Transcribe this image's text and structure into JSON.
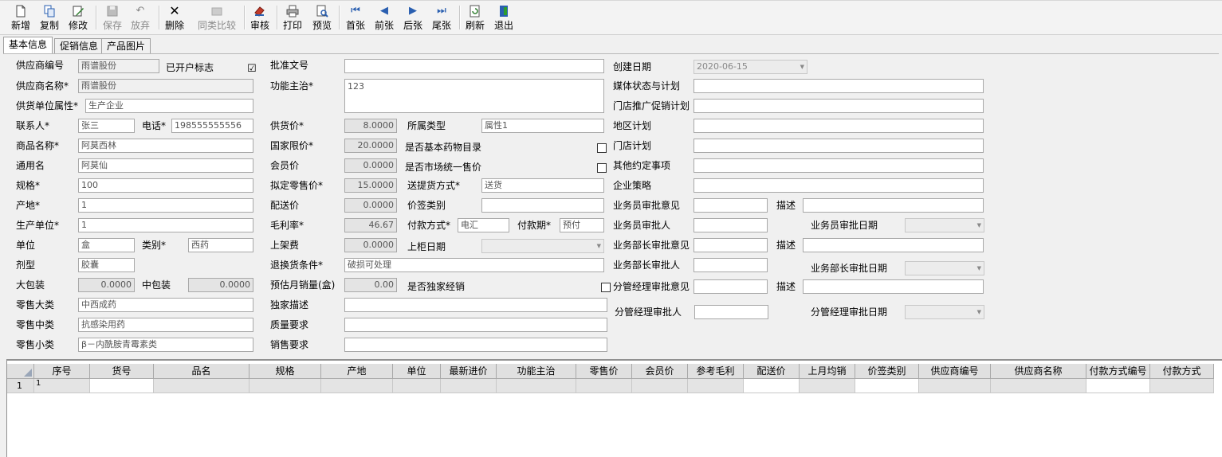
{
  "toolbar": {
    "new": "新增",
    "copy": "复制",
    "edit": "修改",
    "save": "保存",
    "discard": "放弃",
    "delete": "删除",
    "compare": "同类比较",
    "audit": "审核",
    "print": "打印",
    "preview": "预览",
    "first": "首张",
    "prev": "前张",
    "next": "后张",
    "last": "尾张",
    "refresh": "刷新",
    "exit": "退出"
  },
  "tabs": [
    "基本信息",
    "促销信息",
    "产品图片"
  ],
  "form": {
    "supplier_code": {
      "label": "供应商编号",
      "value": "雨谱股份"
    },
    "opened_flag": {
      "label": "已开户标志",
      "checked": "☑"
    },
    "supplier_name": {
      "label": "供应商名称*",
      "value": "雨谱股份"
    },
    "supply_attr": {
      "label": "供货单位属性*",
      "value": "生产企业"
    },
    "contact": {
      "label": "联系人*",
      "value": "张三"
    },
    "phone": {
      "label": "电话*",
      "value": "198555555556"
    },
    "product_name": {
      "label": "商品名称*",
      "value": "阿莫西林"
    },
    "generic_name": {
      "label": "通用名",
      "value": "阿莫仙"
    },
    "spec": {
      "label": "规格*",
      "value": "100"
    },
    "origin": {
      "label": "产地*",
      "value": "1"
    },
    "manufacturer": {
      "label": "生产单位*",
      "value": "1"
    },
    "unit": {
      "label": "单位",
      "value": "盒"
    },
    "category": {
      "label": "类别*",
      "value": "西药"
    },
    "dosage": {
      "label": "剂型",
      "value": "胶囊"
    },
    "big_pack": {
      "label": "大包装",
      "value": "0.0000"
    },
    "mid_pack": {
      "label": "中包装",
      "value": "0.0000"
    },
    "retail_big": {
      "label": "零售大类",
      "value": "中西成药"
    },
    "retail_mid": {
      "label": "零售中类",
      "value": "抗感染用药"
    },
    "retail_small": {
      "label": "零售小类",
      "value": "β－内酰胺青霉素类"
    },
    "approval_no": {
      "label": "批准文号",
      "value": ""
    },
    "function": {
      "label": "功能主治*",
      "value": "123"
    },
    "supply_price": {
      "label": "供货价*",
      "value": "8.0000"
    },
    "belong_type": {
      "label": "所属类型",
      "value": "属性1"
    },
    "limit_price": {
      "label": "国家限价*",
      "value": "20.0000"
    },
    "basic_drug": {
      "label": "是否基本药物目录"
    },
    "member_price": {
      "label": "会员价",
      "value": "0.0000"
    },
    "unified_price": {
      "label": "是否市场统一售价"
    },
    "proposed_retail": {
      "label": "拟定零售价*",
      "value": "15.0000"
    },
    "delivery_mode": {
      "label": "送提货方式*",
      "value": "送货"
    },
    "delivery_price": {
      "label": "配送价",
      "value": "0.0000"
    },
    "price_tag_cat": {
      "label": "价签类别",
      "value": ""
    },
    "gross_margin": {
      "label": "毛利率*",
      "value": "46.67"
    },
    "pay_method": {
      "label": "付款方式*",
      "value": "电汇"
    },
    "pay_term": {
      "label": "付款期*",
      "value": "预付"
    },
    "listing_fee": {
      "label": "上架费",
      "value": "0.0000"
    },
    "shelf_date": {
      "label": "上柜日期",
      "value": ""
    },
    "return_cond": {
      "label": "退换货条件*",
      "value": "破损可处理"
    },
    "est_sales": {
      "label": "预估月销量(盒)",
      "value": "0.00"
    },
    "exclusive": {
      "label": "是否独家经销"
    },
    "exclusive_desc": {
      "label": "独家描述",
      "value": ""
    },
    "quality_req": {
      "label": "质量要求",
      "value": ""
    },
    "sales_req": {
      "label": "销售要求",
      "value": ""
    },
    "created_date": {
      "label": "创建日期",
      "value": "2020-06-15"
    },
    "media_plan": {
      "label": "媒体状态与计划",
      "value": ""
    },
    "store_promo": {
      "label": "门店推广促销计划",
      "value": ""
    },
    "region_plan": {
      "label": "地区计划",
      "value": ""
    },
    "store_plan": {
      "label": "门店计划",
      "value": ""
    },
    "other_terms": {
      "label": "其他约定事项",
      "value": ""
    },
    "strategy": {
      "label": "企业策略",
      "value": ""
    },
    "clerk_opinion": {
      "label": "业务员审批意见",
      "value": ""
    },
    "clerk_desc": {
      "label": "描述",
      "value": ""
    },
    "clerk_approver": {
      "label": "业务员审批人",
      "value": ""
    },
    "clerk_date": {
      "label": "业务员审批日期",
      "value": ""
    },
    "mgr_opinion": {
      "label": "业务部长审批意见",
      "value": ""
    },
    "mgr_desc": {
      "label": "描述",
      "value": ""
    },
    "mgr_approver": {
      "label": "业务部长审批人",
      "value": ""
    },
    "mgr_date": {
      "label": "业务部长审批日期",
      "value": ""
    },
    "gm_opinion": {
      "label": "分管经理审批意见",
      "value": ""
    },
    "gm_desc": {
      "label": "描述",
      "value": ""
    },
    "gm_approver": {
      "label": "分管经理审批人",
      "value": ""
    },
    "gm_date": {
      "label": "分管经理审批日期",
      "value": ""
    }
  },
  "grid": {
    "columns": [
      "序号",
      "货号",
      "品名",
      "规格",
      "产地",
      "单位",
      "最新进价",
      "功能主治",
      "零售价",
      "会员价",
      "参考毛利",
      "配送价",
      "上月均销",
      "价签类别",
      "供应商编号",
      "供应商名称",
      "付款方式编号",
      "付款方式"
    ],
    "row_header": "1",
    "first_cell": "1"
  }
}
